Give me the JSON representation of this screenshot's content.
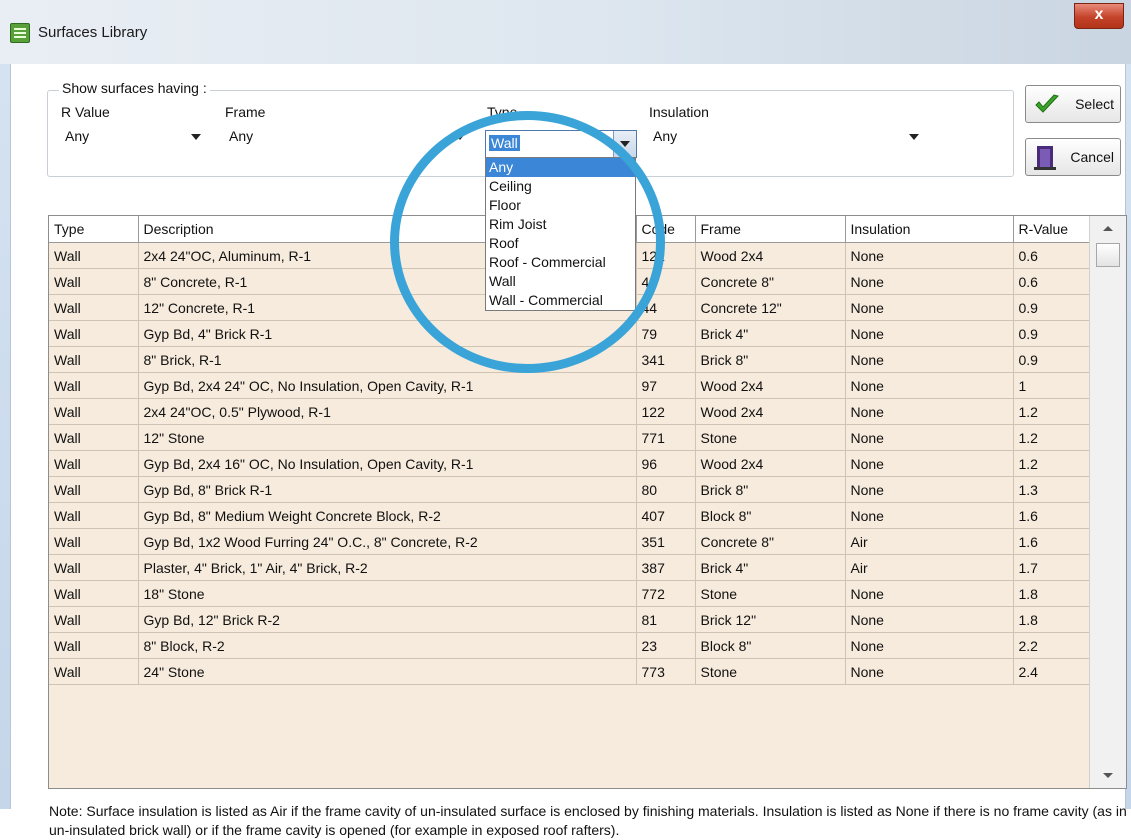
{
  "window": {
    "title": "Surfaces Library",
    "close_label": "x"
  },
  "filters": {
    "caption": "Show surfaces having :",
    "r_value": {
      "label": "R Value",
      "value": "Any"
    },
    "frame": {
      "label": "Frame",
      "value": "Any"
    },
    "type": {
      "label": "Type",
      "value": "Wall"
    },
    "insulation": {
      "label": "Insulation",
      "value": "Any"
    }
  },
  "buttons": {
    "select": "Select",
    "cancel": "Cancel"
  },
  "type_dropdown": {
    "options": [
      "Any",
      "Ceiling",
      "Floor",
      "Rim Joist",
      "Roof",
      "Roof - Commercial",
      "Wall",
      "Wall - Commercial"
    ],
    "highlighted": "Any"
  },
  "table": {
    "columns": [
      "Type",
      "Description",
      "Code",
      "Frame",
      "Insulation",
      "R-Value"
    ],
    "rows": [
      [
        "Wall",
        "2x4 24\"OC, Aluminum, R-1",
        "121",
        "Wood 2x4",
        "None",
        "0.6"
      ],
      [
        "Wall",
        "8\" Concrete, R-1",
        "43",
        "Concrete 8\"",
        "None",
        "0.6"
      ],
      [
        "Wall",
        "12\" Concrete, R-1",
        "44",
        "Concrete 12\"",
        "None",
        "0.9"
      ],
      [
        "Wall",
        "Gyp Bd, 4\" Brick R-1",
        "79",
        "Brick 4\"",
        "None",
        "0.9"
      ],
      [
        "Wall",
        "8\" Brick, R-1",
        "341",
        "Brick 8\"",
        "None",
        "0.9"
      ],
      [
        "Wall",
        "Gyp Bd, 2x4 24\" OC, No Insulation, Open Cavity, R-1",
        "97",
        "Wood 2x4",
        "None",
        "1"
      ],
      [
        "Wall",
        "2x4 24\"OC, 0.5\" Plywood, R-1",
        "122",
        "Wood 2x4",
        "None",
        "1.2"
      ],
      [
        "Wall",
        "12\" Stone",
        "771",
        "Stone",
        "None",
        "1.2"
      ],
      [
        "Wall",
        "Gyp Bd, 2x4 16\" OC, No Insulation, Open Cavity, R-1",
        "96",
        "Wood 2x4",
        "None",
        "1.2"
      ],
      [
        "Wall",
        "Gyp Bd, 8\" Brick R-1",
        "80",
        "Brick 8\"",
        "None",
        "1.3"
      ],
      [
        "Wall",
        "Gyp Bd, 8\" Medium Weight Concrete Block, R-2",
        "407",
        "Block 8\"",
        "None",
        "1.6"
      ],
      [
        "Wall",
        "Gyp Bd, 1x2 Wood Furring 24\" O.C., 8\" Concrete, R-2",
        "351",
        "Concrete 8\"",
        "Air",
        "1.6"
      ],
      [
        "Wall",
        "Plaster, 4\" Brick, 1\" Air, 4\" Brick, R-2",
        "387",
        "Brick 4\"",
        "Air",
        "1.7"
      ],
      [
        "Wall",
        "18\" Stone",
        "772",
        "Stone",
        "None",
        "1.8"
      ],
      [
        "Wall",
        "Gyp Bd, 12\" Brick R-2",
        "81",
        "Brick 12\"",
        "None",
        "1.8"
      ],
      [
        "Wall",
        "8\" Block, R-2",
        "23",
        "Block 8\"",
        "None",
        "2.2"
      ],
      [
        "Wall",
        "24\" Stone",
        "773",
        "Stone",
        "None",
        "2.4"
      ]
    ]
  },
  "note": "Note: Surface insulation is listed as Air if the frame cavity of un-insulated surface is enclosed by finishing materials. Insulation is listed as None if there is no frame cavity (as in un-insulated brick wall) or if the frame cavity is opened (for example in exposed roof rafters).",
  "colors": {
    "accent": "#3b86d6",
    "ring": "#3aa4d8",
    "row_bg": "#f6ebdc"
  }
}
